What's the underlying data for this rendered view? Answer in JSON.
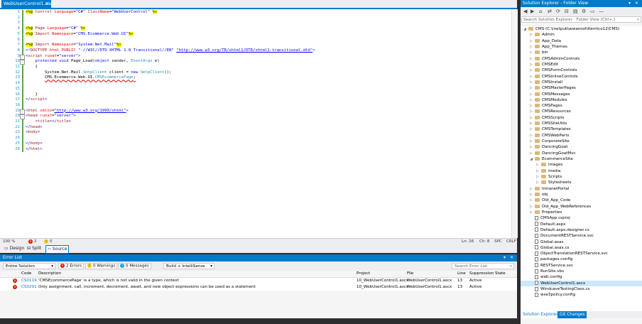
{
  "editor": {
    "tab_title": "WebUserControl1.ascx*",
    "tab_close": "✕",
    "lines": [
      {
        "n": "1",
        "html": "<span class=\"hl\">&lt;%@</span> <span class=\"t\">Control</span> <span class=\"a\">Language</span>=<span class=\"s\">\"C#\"</span> <span class=\"a\">ClassName</span>=<span class=\"s\">\"WebUserControl\"</span> <span class=\"hl\">%&gt;</span>"
      },
      {
        "n": "2",
        "html": ""
      },
      {
        "n": "3",
        "html": ""
      },
      {
        "n": "4",
        "html": "<span class=\"hl\">&lt;%@</span> <span class=\"t\">Page</span> <span class=\"a\">Language</span>=<span class=\"s\">\"C#\"</span> <span class=\"hl\">%&gt;</span>"
      },
      {
        "n": "5",
        "html": "<span class=\"hl\">&lt;%@</span> <span class=\"t\">Import</span> <span class=\"a\">Namespace</span>=<span class=\"s\">\"CMS.Ecommerce.Web.UI\"</span><span class=\"hl\">%&gt;</span>"
      },
      {
        "n": "6",
        "html": ""
      },
      {
        "n": "7",
        "html": "<span class=\"hl\">&lt;%@</span> <span class=\"t\">Import</span> <span class=\"a\">Namespace</span>=<span class=\"s\">\"System.Net.Mail\"</span><span class=\"hl\">%&gt;</span>"
      },
      {
        "n": "8",
        "html": "<span class=\"k\">&lt;!</span><span class=\"t\">DOCTYPE</span> <span class=\"a\">html</span> <span class=\"a\">PUBLIC</span> <span class=\"s\">\"-//W3C//DTD XHTML 1.0 Transitional//EN\"</span> <span class=\"u\">\"http://www.w3.org/TR/xhtml1/DTD/xhtml1-transitional.dtd\"</span><span class=\"k\">&gt;</span>"
      },
      {
        "n": "9",
        "html": "<span class=\"k\">&lt;</span><span class=\"t\">script</span> <span class=\"a\">runat</span>=<span class=\"s\">\"server\"</span><span class=\"k\">&gt;</span>"
      },
      {
        "n": "10",
        "html": "    <span class=\"k\">protected</span> <span class=\"k\">void</span> Page_Load(<span class=\"k\">object</span> sender, <span class=\"ty\">EventArgs</span> e)"
      },
      {
        "n": "11",
        "html": "    {"
      },
      {
        "n": "12",
        "html": "        System.Net.Mail.<span class=\"ty\">SmtpClient</span> client = <span class=\"k\">new</span> <span class=\"ty\">SmtpClient</span>();"
      },
      {
        "n": "13",
        "html": "        <span class=\"err\">CMS.Ecommerce.Web.UI.<span class=\"ty\">CMSEcommercePage</span>;</span>"
      },
      {
        "n": "14",
        "html": ""
      },
      {
        "n": "15",
        "html": ""
      },
      {
        "n": "16",
        "html": "    }"
      },
      {
        "n": "17",
        "html": "<span class=\"k\">&lt;/</span><span class=\"t\">script</span><span class=\"k\">&gt;</span>"
      },
      {
        "n": "18",
        "html": ""
      },
      {
        "n": "19",
        "html": "<span class=\"k\">&lt;</span><span class=\"t\">html</span> <span class=\"a\">xmlns</span>=<span class=\"u\">\"http://www.w3.org/1999/xhtml\"</span><span class=\"k\">&gt;</span>"
      },
      {
        "n": "20",
        "html": "<span class=\"k\">&lt;</span><span class=\"t\">head</span> <span class=\"a\">runat</span>=<span class=\"s\">\"server\"</span><span class=\"k\">&gt;</span>"
      },
      {
        "n": "21",
        "html": "    <span class=\"k\">&lt;</span><span class=\"t\">title</span><span class=\"k\">&gt;&lt;/</span><span class=\"t\">title</span><span class=\"k\">&gt;</span>"
      },
      {
        "n": "22",
        "html": "<span class=\"k\">&lt;/</span><span class=\"t\">head</span><span class=\"k\">&gt;</span>"
      },
      {
        "n": "23",
        "html": "<span class=\"k\">&lt;</span><span class=\"t\">body</span><span class=\"k\">&gt;</span>"
      },
      {
        "n": "24",
        "html": ""
      },
      {
        "n": "25",
        "html": "<span class=\"k\">&lt;/</span><span class=\"t\">body</span><span class=\"k\">&gt;</span>"
      },
      {
        "n": "26",
        "html": "<span class=\"k\">&lt;/</span><span class=\"t\">html</span><span class=\"k\">&gt;</span>"
      }
    ],
    "status": {
      "zoom": "100 %",
      "errors": "2",
      "warnings": "0",
      "ln": "Ln: 26",
      "ch": "Ch: 8",
      "spc": "SPC",
      "crlf": "CRLF"
    },
    "views": {
      "design": "Design",
      "split": "Split",
      "source": "Source"
    }
  },
  "error_list": {
    "title": "Error List",
    "scope": "Entire Solution",
    "errors_btn": "2 Errors",
    "warnings_btn": "0 Warnings",
    "messages_btn": "0 Messages",
    "build_filter": "Build + IntelliSense",
    "search_placeholder": "Search Error List",
    "columns": {
      "code": "Code",
      "description": "Description",
      "project": "Project",
      "file": "File",
      "line": "Line",
      "suppression": "Suppression State"
    },
    "rows": [
      {
        "code": "CS0119",
        "description": "'CMSEcommercePage' is a type, which is not valid in the given context",
        "project": "10_WebUserControl1.ascx",
        "file": "WebUserControl1.ascx",
        "line": "13",
        "state": "Active"
      },
      {
        "code": "CS0201",
        "description": "Only assignment, call, increment, decrement, await, and new object expressions can be used as a statement",
        "project": "10_WebUserControl1.ascx",
        "file": "WebUserControl1.ascx",
        "line": "13",
        "state": "Active"
      }
    ]
  },
  "solution_explorer": {
    "title": "Solution Explorer - Folder View",
    "search_placeholder": "Search Solution Explorer - Folder View (Ctrl+;)",
    "tabs": {
      "solution": "Solution Explorer",
      "git": "Git Changes"
    },
    "items": [
      {
        "label": "CMS (C:\\inetpub\\wwwroot\\Kentico12\\CMS)",
        "indent": 0,
        "arrow": "◢",
        "type": "folder"
      },
      {
        "label": "Admin",
        "indent": 1,
        "arrow": "▷",
        "type": "folder"
      },
      {
        "label": "App_Data",
        "indent": 1,
        "arrow": "▷",
        "type": "folder"
      },
      {
        "label": "App_Themes",
        "indent": 1,
        "arrow": "▷",
        "type": "folder"
      },
      {
        "label": "bin",
        "indent": 1,
        "arrow": "▷",
        "type": "folder"
      },
      {
        "label": "CMSAdminControls",
        "indent": 1,
        "arrow": "▷",
        "type": "folder"
      },
      {
        "label": "CMSEdit",
        "indent": 1,
        "arrow": "▷",
        "type": "folder"
      },
      {
        "label": "CMSFormControls",
        "indent": 1,
        "arrow": "▷",
        "type": "folder"
      },
      {
        "label": "CMSInlineControls",
        "indent": 1,
        "arrow": "▷",
        "type": "folder"
      },
      {
        "label": "CMSInstall",
        "indent": 1,
        "arrow": "▷",
        "type": "folder"
      },
      {
        "label": "CMSMasterPages",
        "indent": 1,
        "arrow": "▷",
        "type": "folder"
      },
      {
        "label": "CMSMessages",
        "indent": 1,
        "arrow": "▷",
        "type": "folder"
      },
      {
        "label": "CMSModules",
        "indent": 1,
        "arrow": "▷",
        "type": "folder"
      },
      {
        "label": "CMSPages",
        "indent": 1,
        "arrow": "▷",
        "type": "folder"
      },
      {
        "label": "CMSResources",
        "indent": 1,
        "arrow": "▷",
        "type": "folder"
      },
      {
        "label": "CMSScripts",
        "indent": 1,
        "arrow": "▷",
        "type": "folder"
      },
      {
        "label": "CMSSiteUtils",
        "indent": 1,
        "arrow": "▷",
        "type": "folder"
      },
      {
        "label": "CMSTemplates",
        "indent": 1,
        "arrow": "▷",
        "type": "folder"
      },
      {
        "label": "CMSWebParts",
        "indent": 1,
        "arrow": "▷",
        "type": "folder"
      },
      {
        "label": "CorporateSite",
        "indent": 1,
        "arrow": "▷",
        "type": "folder"
      },
      {
        "label": "DancingGoat",
        "indent": 1,
        "arrow": "▷",
        "type": "folder"
      },
      {
        "label": "DancingGoatMvc",
        "indent": 1,
        "arrow": "▷",
        "type": "folder"
      },
      {
        "label": "EcommerceSite",
        "indent": 1,
        "arrow": "◢",
        "type": "folder"
      },
      {
        "label": "images",
        "indent": 2,
        "arrow": "▷",
        "type": "folder"
      },
      {
        "label": "media",
        "indent": 2,
        "arrow": "▷",
        "type": "folder"
      },
      {
        "label": "Scripts",
        "indent": 2,
        "arrow": "▷",
        "type": "folder"
      },
      {
        "label": "Stylesheets",
        "indent": 2,
        "arrow": "▷",
        "type": "folder"
      },
      {
        "label": "IntranetPortal",
        "indent": 1,
        "arrow": "▷",
        "type": "folder"
      },
      {
        "label": "obj",
        "indent": 1,
        "arrow": "▷",
        "type": "folder"
      },
      {
        "label": "Old_App_Code",
        "indent": 1,
        "arrow": "▷",
        "type": "folder"
      },
      {
        "label": "Old_App_WebReferences",
        "indent": 1,
        "arrow": "▷",
        "type": "folder"
      },
      {
        "label": "Properties",
        "indent": 1,
        "arrow": "▷",
        "type": "folder"
      },
      {
        "label": "CMSApp.csproj",
        "indent": 1,
        "arrow": "",
        "type": "file"
      },
      {
        "label": "Default.aspx",
        "indent": 1,
        "arrow": "",
        "type": "file"
      },
      {
        "label": "Default.aspx.designer.cs",
        "indent": 1,
        "arrow": "",
        "type": "file"
      },
      {
        "label": "DocumentRESTService.svc",
        "indent": 1,
        "arrow": "",
        "type": "file"
      },
      {
        "label": "Global.asax",
        "indent": 1,
        "arrow": "",
        "type": "file"
      },
      {
        "label": "Global.asax.cs",
        "indent": 1,
        "arrow": "",
        "type": "file"
      },
      {
        "label": "ObjectTranslationRESTService.svc",
        "indent": 1,
        "arrow": "",
        "type": "file"
      },
      {
        "label": "packages.config",
        "indent": 1,
        "arrow": "",
        "type": "file"
      },
      {
        "label": "RESTService.svc",
        "indent": 1,
        "arrow": "",
        "type": "file"
      },
      {
        "label": "RunSite.vbs",
        "indent": 1,
        "arrow": "",
        "type": "file"
      },
      {
        "label": "web.config",
        "indent": 1,
        "arrow": "",
        "type": "file"
      },
      {
        "label": "WebUserControl1.ascx",
        "indent": 1,
        "arrow": "",
        "type": "file",
        "selected": true
      },
      {
        "label": "WindcaveTestingClass.cs",
        "indent": 1,
        "arrow": "",
        "type": "file"
      },
      {
        "label": "wse3policy.config",
        "indent": 1,
        "arrow": "",
        "type": "file"
      }
    ]
  },
  "colors": {
    "accent": "#007acc",
    "error": "#e51400",
    "warning": "#f2c811",
    "info": "#1ba1e2"
  }
}
